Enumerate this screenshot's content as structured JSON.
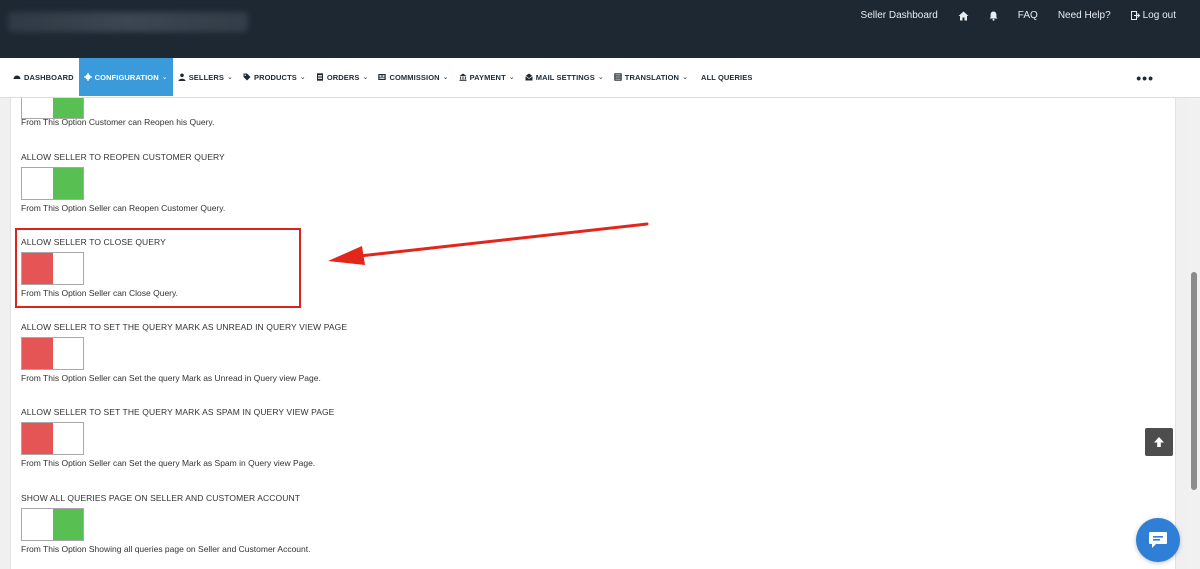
{
  "topbar": {
    "links": [
      {
        "label": "Seller Dashboard"
      },
      {
        "icon": "home-icon"
      },
      {
        "icon": "bell-icon"
      },
      {
        "label": "FAQ"
      },
      {
        "label": "Need Help?"
      },
      {
        "label": "Log out",
        "icon": "logout-icon"
      }
    ]
  },
  "nav": {
    "items": [
      {
        "label": "DASHBOARD",
        "icon": "dashboard-icon",
        "dropdown": false,
        "active": false
      },
      {
        "label": "CONFIGURATION",
        "icon": "gear-icon",
        "dropdown": true,
        "active": true
      },
      {
        "label": "SELLERS",
        "icon": "user-icon",
        "dropdown": true,
        "active": false
      },
      {
        "label": "PRODUCTS",
        "icon": "tag-icon",
        "dropdown": true,
        "active": false
      },
      {
        "label": "ORDERS",
        "icon": "document-icon",
        "dropdown": true,
        "active": false
      },
      {
        "label": "COMMISSION",
        "icon": "commission-icon",
        "dropdown": true,
        "active": false
      },
      {
        "label": "PAYMENT",
        "icon": "payment-icon",
        "dropdown": true,
        "active": false
      },
      {
        "label": "MAIL SETTINGS",
        "icon": "mail-icon",
        "dropdown": true,
        "active": false
      },
      {
        "label": "TRANSLATION",
        "icon": "translation-icon",
        "dropdown": true,
        "active": false
      },
      {
        "label": "ALL QUERIES",
        "icon": null,
        "dropdown": false,
        "active": false
      }
    ],
    "more": "•••"
  },
  "settings": [
    {
      "title": "",
      "state": "on",
      "description": "From This Option Customer can Reopen his Query."
    },
    {
      "title": "ALLOW SELLER TO REOPEN CUSTOMER QUERY",
      "state": "on",
      "description": "From This Option Seller can Reopen Customer Query."
    },
    {
      "title": "ALLOW SELLER TO CLOSE QUERY",
      "state": "off",
      "description": "From This Option Seller can Close Query.",
      "highlighted": true
    },
    {
      "title": "ALLOW SELLER TO SET THE QUERY MARK AS UNREAD IN QUERY VIEW PAGE",
      "state": "off",
      "description": "From This Option Seller can Set the query Mark as Unread in Query view Page."
    },
    {
      "title": "ALLOW SELLER TO SET THE QUERY MARK AS SPAM IN QUERY VIEW PAGE",
      "state": "off",
      "description": "From This Option Seller can Set the query Mark as Spam in Query view Page."
    },
    {
      "title": "SHOW ALL QUERIES PAGE ON SELLER AND CUSTOMER ACCOUNT",
      "state": "on",
      "description": "From This Option Showing all queries page on Seller and Customer Account."
    }
  ],
  "colors": {
    "toggle_on": "#58c052",
    "toggle_off": "#e65555",
    "highlight": "#d9251c",
    "active_nav": "#3b9ad9"
  }
}
